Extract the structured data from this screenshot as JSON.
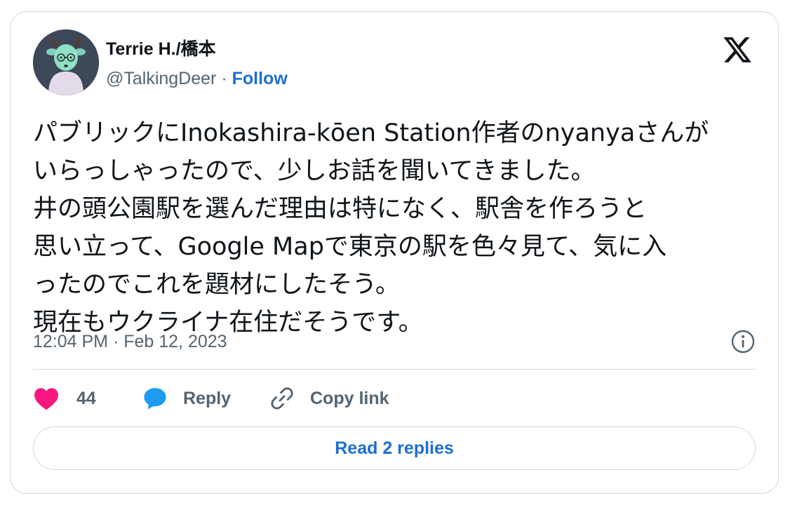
{
  "author": {
    "display_name": "Terrie H./橋本",
    "handle": "@TalkingDeer",
    "separator": "·",
    "follow_label": "Follow",
    "avatar_icon": "deer-avatar-icon"
  },
  "platform_icon": "x-logo-icon",
  "tweet": {
    "lines": [
      "パブリックにInokashira-kōen Station作者のnyanyaさんが",
      "いらっしゃったので、少しお話を聞いてきました。",
      "井の頭公園駅を選んだ理由は特になく、駅舎を作ろうと",
      "思い立って、Google Mapで東京の駅を色々見て、気に入",
      "ったのでこれを題材にしたそう。",
      "現在もウクライナ在住だそうです。"
    ],
    "timestamp": "12:04 PM · Feb 12, 2023"
  },
  "actions": {
    "like_count": "44",
    "reply_label": "Reply",
    "copy_link_label": "Copy link"
  },
  "read_replies_label": "Read 2 replies",
  "colors": {
    "link": "#1d6fd1",
    "like": "#f91880",
    "reply": "#1d9bf0",
    "muted": "#536471",
    "border": "#cfd9de"
  }
}
